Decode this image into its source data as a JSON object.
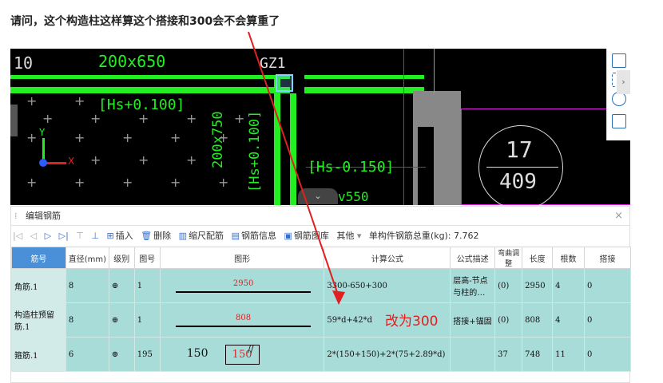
{
  "question": "请问，这个构造柱这样算这个搭接和300会不会算重了",
  "cad": {
    "label_left": "10",
    "label_dim": "200x650",
    "label_gz": "GZ1",
    "label_hs1": "[Hs+0.100]",
    "label_hs2": "[Hs-0.150]",
    "label_vert1": "200x750",
    "label_vert2": "[Hs+0.100]",
    "label_bottom": "v550",
    "circle_top": "17",
    "circle_bottom": "409"
  },
  "editor": {
    "title": "编辑钢筋",
    "close": "×"
  },
  "toolbar": {
    "insert": "插入",
    "delete": "删除",
    "scale": "缩尺配筋",
    "info": "钢筋信息",
    "library": "钢筋图库",
    "other": "其他",
    "total": "单构件钢筋总重(kg): 7.762"
  },
  "columns": [
    "筋号",
    "直径(mm)",
    "级别",
    "图号",
    "图形",
    "计算公式",
    "公式描述",
    "弯曲调整",
    "长度",
    "根数",
    "搭接"
  ],
  "rows": [
    {
      "name": "角筋.1",
      "dia": "8",
      "grade": "⊕",
      "fig": "1",
      "shape": "2950",
      "formula": "3300-650+300",
      "desc": "层高-节点与柱的…",
      "bend": "(0)",
      "length": "2950",
      "count": "4",
      "lap": "0"
    },
    {
      "name": "构造柱预留筋.1",
      "dia": "8",
      "grade": "⊕",
      "fig": "1",
      "shape": "808",
      "formula": "59*d+42*d",
      "desc": "搭接+锚固",
      "bend": "(0)",
      "length": "808",
      "count": "4",
      "lap": "0"
    },
    {
      "name": "箍筋.1",
      "dia": "6",
      "grade": "⊕",
      "fig": "195",
      "shape_a": "150",
      "shape_b": "150",
      "formula": "2*(150+150)+2*(75+2.89*d)",
      "desc": "",
      "bend": "37",
      "length": "748",
      "count": "11",
      "lap": "0"
    }
  ],
  "annotation": "改为300",
  "colors": {
    "cad_green": "#22ee22",
    "row_bg": "#a8dcd9",
    "header_selected": "#4a90d9",
    "annotation": "#e02020"
  }
}
